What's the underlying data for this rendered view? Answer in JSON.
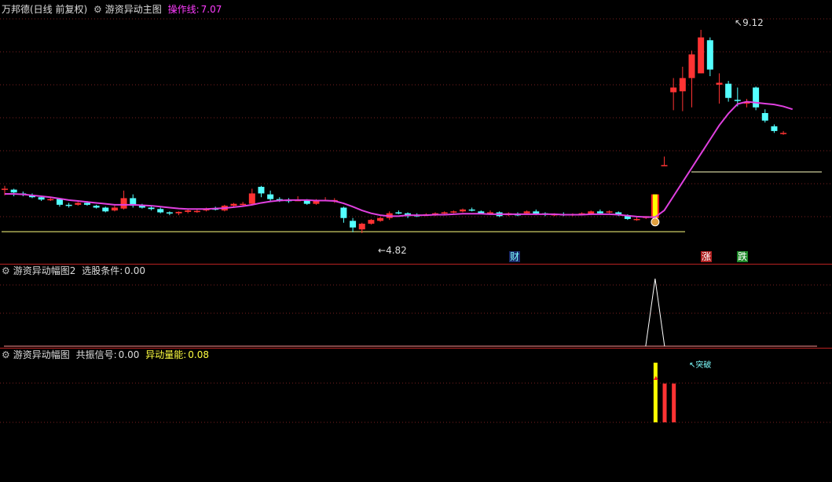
{
  "main_panel": {
    "stock_name": "万邦德(日线 前复权)",
    "indicator_name": "游资异动主图",
    "line_label": "操作线:",
    "line_value": "7.07",
    "high_label": "9.12",
    "low_label": "4.82",
    "tags": {
      "cai": "财",
      "zhang": "涨",
      "die": "跌"
    }
  },
  "panel2": {
    "indicator_name": "游资异动幅图2",
    "signal_label": "选股条件:",
    "signal_value": "0.00"
  },
  "panel3": {
    "indicator_name": "游资异动幅图",
    "signal_label": "共振信号:",
    "signal_value": "0.00",
    "energy_label": "异动量能:",
    "energy_value": "0.08",
    "marker_text": "突破"
  },
  "colors": {
    "background": "#000000",
    "up": "#ff3333",
    "down": "#54ffff",
    "ma_line": "#e040e0",
    "support_line": "#ffff80",
    "signal_yellow": "#ffff00",
    "grid": "#7a1f1f"
  },
  "chart_data": {
    "type": "candlestick",
    "price_ticks_shown": [
      "9.12",
      "4.82"
    ],
    "candles": [
      {
        "o": 5.76,
        "h": 5.82,
        "l": 5.62,
        "c": 5.74,
        "up": true
      },
      {
        "o": 5.74,
        "h": 5.76,
        "l": 5.6,
        "c": 5.68,
        "up": false
      },
      {
        "o": 5.66,
        "h": 5.7,
        "l": 5.6,
        "c": 5.63,
        "up": false
      },
      {
        "o": 5.62,
        "h": 5.66,
        "l": 5.56,
        "c": 5.58,
        "up": false
      },
      {
        "o": 5.58,
        "h": 5.6,
        "l": 5.5,
        "c": 5.53,
        "up": false
      },
      {
        "o": 5.54,
        "h": 5.57,
        "l": 5.5,
        "c": 5.54,
        "up": true
      },
      {
        "o": 5.54,
        "h": 5.56,
        "l": 5.38,
        "c": 5.42,
        "up": false
      },
      {
        "o": 5.42,
        "h": 5.46,
        "l": 5.36,
        "c": 5.4,
        "up": false
      },
      {
        "o": 5.42,
        "h": 5.48,
        "l": 5.4,
        "c": 5.46,
        "up": true
      },
      {
        "o": 5.46,
        "h": 5.5,
        "l": 5.4,
        "c": 5.42,
        "up": false
      },
      {
        "o": 5.4,
        "h": 5.42,
        "l": 5.34,
        "c": 5.36,
        "up": false
      },
      {
        "o": 5.36,
        "h": 5.38,
        "l": 5.26,
        "c": 5.28,
        "up": false
      },
      {
        "o": 5.3,
        "h": 5.4,
        "l": 5.28,
        "c": 5.36,
        "up": true
      },
      {
        "o": 5.34,
        "h": 5.72,
        "l": 5.32,
        "c": 5.56,
        "up": true
      },
      {
        "o": 5.56,
        "h": 5.64,
        "l": 5.36,
        "c": 5.4,
        "up": false
      },
      {
        "o": 5.4,
        "h": 5.44,
        "l": 5.34,
        "c": 5.36,
        "up": false
      },
      {
        "o": 5.36,
        "h": 5.4,
        "l": 5.3,
        "c": 5.33,
        "up": false
      },
      {
        "o": 5.33,
        "h": 5.36,
        "l": 5.24,
        "c": 5.26,
        "up": false
      },
      {
        "o": 5.26,
        "h": 5.28,
        "l": 5.2,
        "c": 5.24,
        "up": false
      },
      {
        "o": 5.24,
        "h": 5.28,
        "l": 5.2,
        "c": 5.27,
        "up": true
      },
      {
        "o": 5.27,
        "h": 5.32,
        "l": 5.24,
        "c": 5.3,
        "up": true
      },
      {
        "o": 5.29,
        "h": 5.32,
        "l": 5.25,
        "c": 5.29,
        "up": true
      },
      {
        "o": 5.3,
        "h": 5.36,
        "l": 5.28,
        "c": 5.34,
        "up": true
      },
      {
        "o": 5.34,
        "h": 5.38,
        "l": 5.3,
        "c": 5.32,
        "up": false
      },
      {
        "o": 5.3,
        "h": 5.42,
        "l": 5.28,
        "c": 5.4,
        "up": true
      },
      {
        "o": 5.4,
        "h": 5.46,
        "l": 5.36,
        "c": 5.44,
        "up": true
      },
      {
        "o": 5.42,
        "h": 5.48,
        "l": 5.4,
        "c": 5.44,
        "up": true
      },
      {
        "o": 5.44,
        "h": 5.76,
        "l": 5.42,
        "c": 5.66,
        "up": true
      },
      {
        "o": 5.66,
        "h": 5.82,
        "l": 5.58,
        "c": 5.8,
        "up": false
      },
      {
        "o": 5.64,
        "h": 5.72,
        "l": 5.5,
        "c": 5.54,
        "up": false
      },
      {
        "o": 5.54,
        "h": 5.58,
        "l": 5.48,
        "c": 5.52,
        "up": false
      },
      {
        "o": 5.52,
        "h": 5.56,
        "l": 5.46,
        "c": 5.5,
        "up": false
      },
      {
        "o": 5.52,
        "h": 5.6,
        "l": 5.5,
        "c": 5.52,
        "up": true
      },
      {
        "o": 5.52,
        "h": 5.54,
        "l": 5.42,
        "c": 5.44,
        "up": false
      },
      {
        "o": 5.44,
        "h": 5.54,
        "l": 5.42,
        "c": 5.52,
        "up": true
      },
      {
        "o": 5.52,
        "h": 5.58,
        "l": 5.5,
        "c": 5.52,
        "up": true
      },
      {
        "o": 5.52,
        "h": 5.56,
        "l": 5.46,
        "c": 5.52,
        "up": true
      },
      {
        "o": 5.36,
        "h": 5.38,
        "l": 5.04,
        "c": 5.14,
        "up": false
      },
      {
        "o": 5.08,
        "h": 5.14,
        "l": 4.84,
        "c": 4.94,
        "up": false
      },
      {
        "o": 4.9,
        "h": 5.04,
        "l": 4.82,
        "c": 5.02,
        "up": true
      },
      {
        "o": 5.02,
        "h": 5.12,
        "l": 5.0,
        "c": 5.1,
        "up": true
      },
      {
        "o": 5.08,
        "h": 5.16,
        "l": 5.06,
        "c": 5.14,
        "up": true
      },
      {
        "o": 5.14,
        "h": 5.28,
        "l": 5.1,
        "c": 5.24,
        "up": true
      },
      {
        "o": 5.26,
        "h": 5.3,
        "l": 5.22,
        "c": 5.25,
        "up": false
      },
      {
        "o": 5.24,
        "h": 5.26,
        "l": 5.14,
        "c": 5.18,
        "up": false
      },
      {
        "o": 5.2,
        "h": 5.24,
        "l": 5.16,
        "c": 5.18,
        "up": false
      },
      {
        "o": 5.2,
        "h": 5.24,
        "l": 5.18,
        "c": 5.22,
        "up": true
      },
      {
        "o": 5.2,
        "h": 5.26,
        "l": 5.18,
        "c": 5.24,
        "up": true
      },
      {
        "o": 5.24,
        "h": 5.28,
        "l": 5.22,
        "c": 5.26,
        "up": true
      },
      {
        "o": 5.26,
        "h": 5.3,
        "l": 5.24,
        "c": 5.28,
        "up": true
      },
      {
        "o": 5.28,
        "h": 5.34,
        "l": 5.26,
        "c": 5.32,
        "up": true
      },
      {
        "o": 5.32,
        "h": 5.36,
        "l": 5.28,
        "c": 5.3,
        "up": false
      },
      {
        "o": 5.28,
        "h": 5.3,
        "l": 5.22,
        "c": 5.24,
        "up": false
      },
      {
        "o": 5.26,
        "h": 5.3,
        "l": 5.22,
        "c": 5.26,
        "up": true
      },
      {
        "o": 5.26,
        "h": 5.28,
        "l": 5.16,
        "c": 5.18,
        "up": false
      },
      {
        "o": 5.2,
        "h": 5.26,
        "l": 5.18,
        "c": 5.24,
        "up": true
      },
      {
        "o": 5.22,
        "h": 5.26,
        "l": 5.18,
        "c": 5.2,
        "up": false
      },
      {
        "o": 5.24,
        "h": 5.3,
        "l": 5.22,
        "c": 5.28,
        "up": true
      },
      {
        "o": 5.28,
        "h": 5.32,
        "l": 5.2,
        "c": 5.22,
        "up": false
      },
      {
        "o": 5.24,
        "h": 5.26,
        "l": 5.18,
        "c": 5.22,
        "up": false
      },
      {
        "o": 5.22,
        "h": 5.24,
        "l": 5.18,
        "c": 5.22,
        "up": true
      },
      {
        "o": 5.22,
        "h": 5.26,
        "l": 5.18,
        "c": 5.2,
        "up": false
      },
      {
        "o": 5.2,
        "h": 5.24,
        "l": 5.18,
        "c": 5.22,
        "up": true
      },
      {
        "o": 5.22,
        "h": 5.26,
        "l": 5.2,
        "c": 5.24,
        "up": true
      },
      {
        "o": 5.22,
        "h": 5.3,
        "l": 5.2,
        "c": 5.28,
        "up": true
      },
      {
        "o": 5.28,
        "h": 5.32,
        "l": 5.22,
        "c": 5.24,
        "up": false
      },
      {
        "o": 5.26,
        "h": 5.3,
        "l": 5.24,
        "c": 5.28,
        "up": true
      },
      {
        "o": 5.26,
        "h": 5.28,
        "l": 5.18,
        "c": 5.22,
        "up": false
      },
      {
        "o": 5.2,
        "h": 5.22,
        "l": 5.1,
        "c": 5.12,
        "up": false
      },
      {
        "o": 5.12,
        "h": 5.16,
        "l": 5.08,
        "c": 5.12,
        "up": true
      },
      {
        "o": 5.14,
        "h": 5.18,
        "l": 5.12,
        "c": 5.18,
        "up": true
      },
      {
        "o": 5.14,
        "h": 5.64,
        "l": 5.14,
        "c": 5.64,
        "up": true,
        "signal": true
      },
      {
        "o": 6.24,
        "h": 6.44,
        "l": 6.24,
        "c": 6.26,
        "up": true
      },
      {
        "o": 7.8,
        "h": 8.1,
        "l": 7.42,
        "c": 7.9,
        "up": true
      },
      {
        "o": 7.82,
        "h": 8.34,
        "l": 7.4,
        "c": 8.1,
        "up": true
      },
      {
        "o": 8.1,
        "h": 8.68,
        "l": 7.48,
        "c": 8.6,
        "up": true
      },
      {
        "o": 8.2,
        "h": 9.12,
        "l": 8.2,
        "c": 8.96,
        "up": true
      },
      {
        "o": 8.9,
        "h": 8.96,
        "l": 8.14,
        "c": 8.28,
        "up": false
      },
      {
        "o": 7.96,
        "h": 8.2,
        "l": 7.56,
        "c": 8.0,
        "up": true
      },
      {
        "o": 7.98,
        "h": 8.04,
        "l": 7.6,
        "c": 7.68,
        "up": false
      },
      {
        "o": 7.64,
        "h": 7.9,
        "l": 7.5,
        "c": 7.62,
        "up": false
      },
      {
        "o": 7.56,
        "h": 7.66,
        "l": 7.48,
        "c": 7.6,
        "up": true
      },
      {
        "o": 7.9,
        "h": 7.92,
        "l": 7.42,
        "c": 7.48,
        "up": false
      },
      {
        "o": 7.36,
        "h": 7.44,
        "l": 7.16,
        "c": 7.2,
        "up": false
      },
      {
        "o": 7.08,
        "h": 7.12,
        "l": 6.94,
        "c": 6.98,
        "up": false
      },
      {
        "o": 6.94,
        "h": 6.98,
        "l": 6.9,
        "c": 6.94,
        "up": true
      }
    ],
    "ma_line": [
      5.65,
      5.65,
      5.64,
      5.62,
      5.6,
      5.58,
      5.55,
      5.52,
      5.5,
      5.48,
      5.46,
      5.44,
      5.42,
      5.42,
      5.42,
      5.41,
      5.4,
      5.38,
      5.36,
      5.34,
      5.33,
      5.33,
      5.33,
      5.34,
      5.35,
      5.37,
      5.39,
      5.42,
      5.46,
      5.49,
      5.51,
      5.52,
      5.52,
      5.52,
      5.51,
      5.51,
      5.5,
      5.45,
      5.38,
      5.3,
      5.24,
      5.2,
      5.18,
      5.18,
      5.2,
      5.2,
      5.2,
      5.21,
      5.21,
      5.22,
      5.23,
      5.23,
      5.23,
      5.22,
      5.22,
      5.22,
      5.22,
      5.22,
      5.22,
      5.22,
      5.22,
      5.21,
      5.21,
      5.21,
      5.22,
      5.22,
      5.22,
      5.21,
      5.19,
      5.17,
      5.16,
      5.16,
      5.3,
      5.6,
      5.9,
      6.2,
      6.5,
      6.8,
      7.1,
      7.35,
      7.55,
      7.6,
      7.58,
      7.56,
      7.54,
      7.5,
      7.44
    ],
    "support_line_value": 4.9,
    "panel2_spike_index": 71,
    "panel3_bars": [
      {
        "index": 71,
        "color": "yellow",
        "level": 1.0
      },
      {
        "index": 72,
        "color": "red",
        "level": 0.65
      },
      {
        "index": 73,
        "color": "red",
        "level": 0.65
      }
    ]
  }
}
